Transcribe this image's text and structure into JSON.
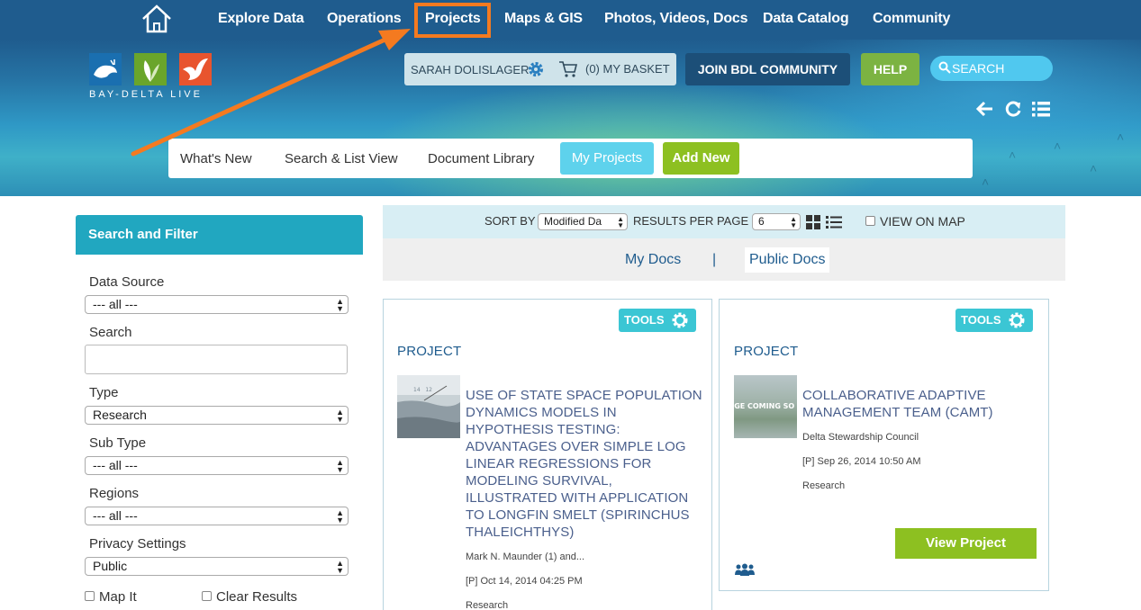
{
  "topnav": {
    "items": [
      "Explore Data",
      "Operations",
      "Projects",
      "Maps & GIS",
      "Photos, Videos, Docs",
      "Data Catalog",
      "Community"
    ],
    "highlight_color": "#f47a20"
  },
  "brand": {
    "logo_text": "BAY-DELTA LIVE",
    "logo_colors": [
      "#1a6fb0",
      "#6aa52b",
      "#e8542e"
    ]
  },
  "user": {
    "name": "SARAH DOLISLAGER",
    "basket": "(0) MY BASKET"
  },
  "header_buttons": {
    "join": "JOIN BDL COMMUNITY",
    "help": "HELP",
    "search_placeholder": "SEARCH"
  },
  "subnav": {
    "items": [
      "What's New",
      "Search & List View",
      "Document Library"
    ],
    "active": "My Projects",
    "add": "Add New"
  },
  "filter": {
    "title": "Search and Filter",
    "data_source_label": "Data Source",
    "data_source_value": "--- all ---",
    "search_label": "Search",
    "type_label": "Type",
    "type_value": "Research",
    "subtype_label": "Sub Type",
    "subtype_value": "--- all ---",
    "regions_label": "Regions",
    "regions_value": "--- all ---",
    "privacy_label": "Privacy Settings",
    "privacy_value": "Public",
    "map_it": "Map It",
    "clear_results": "Clear Results"
  },
  "results": {
    "sort_label": "SORT BY",
    "sort_value": "Modified Da",
    "per_page_label": "RESULTS PER PAGE",
    "per_page_value": "6",
    "view_on_map": "VIEW ON MAP",
    "tab_my_docs": "My Docs",
    "separator": "|",
    "tab_public_docs": "Public Docs"
  },
  "cards": [
    {
      "tools": "TOOLS",
      "type": "PROJECT",
      "title": "USE OF STATE SPACE POPULATION DYNAMICS MODELS IN HYPOTHESIS TESTING: ADVANTAGES OVER SIMPLE LOG LINEAR REGRESSIONS FOR MODELING SURVIVAL, ILLUSTRATED WITH APPLICATION TO LONGFIN SMELT (SPIRINCHUS THALEICHTHYS)",
      "author": "Mark N. Maunder (1) and...",
      "date": "[P] Oct 14, 2014 04:25 PM",
      "category": "Research"
    },
    {
      "tools": "TOOLS",
      "type": "PROJECT",
      "thumb_text": "AGE COMING SO",
      "title": "COLLABORATIVE ADAPTIVE MANAGEMENT TEAM (CAMT)",
      "author": "Delta Stewardship Council",
      "date": "[P] Sep 26, 2014 10:50 AM",
      "category": "Research",
      "view_button": "View Project"
    }
  ]
}
